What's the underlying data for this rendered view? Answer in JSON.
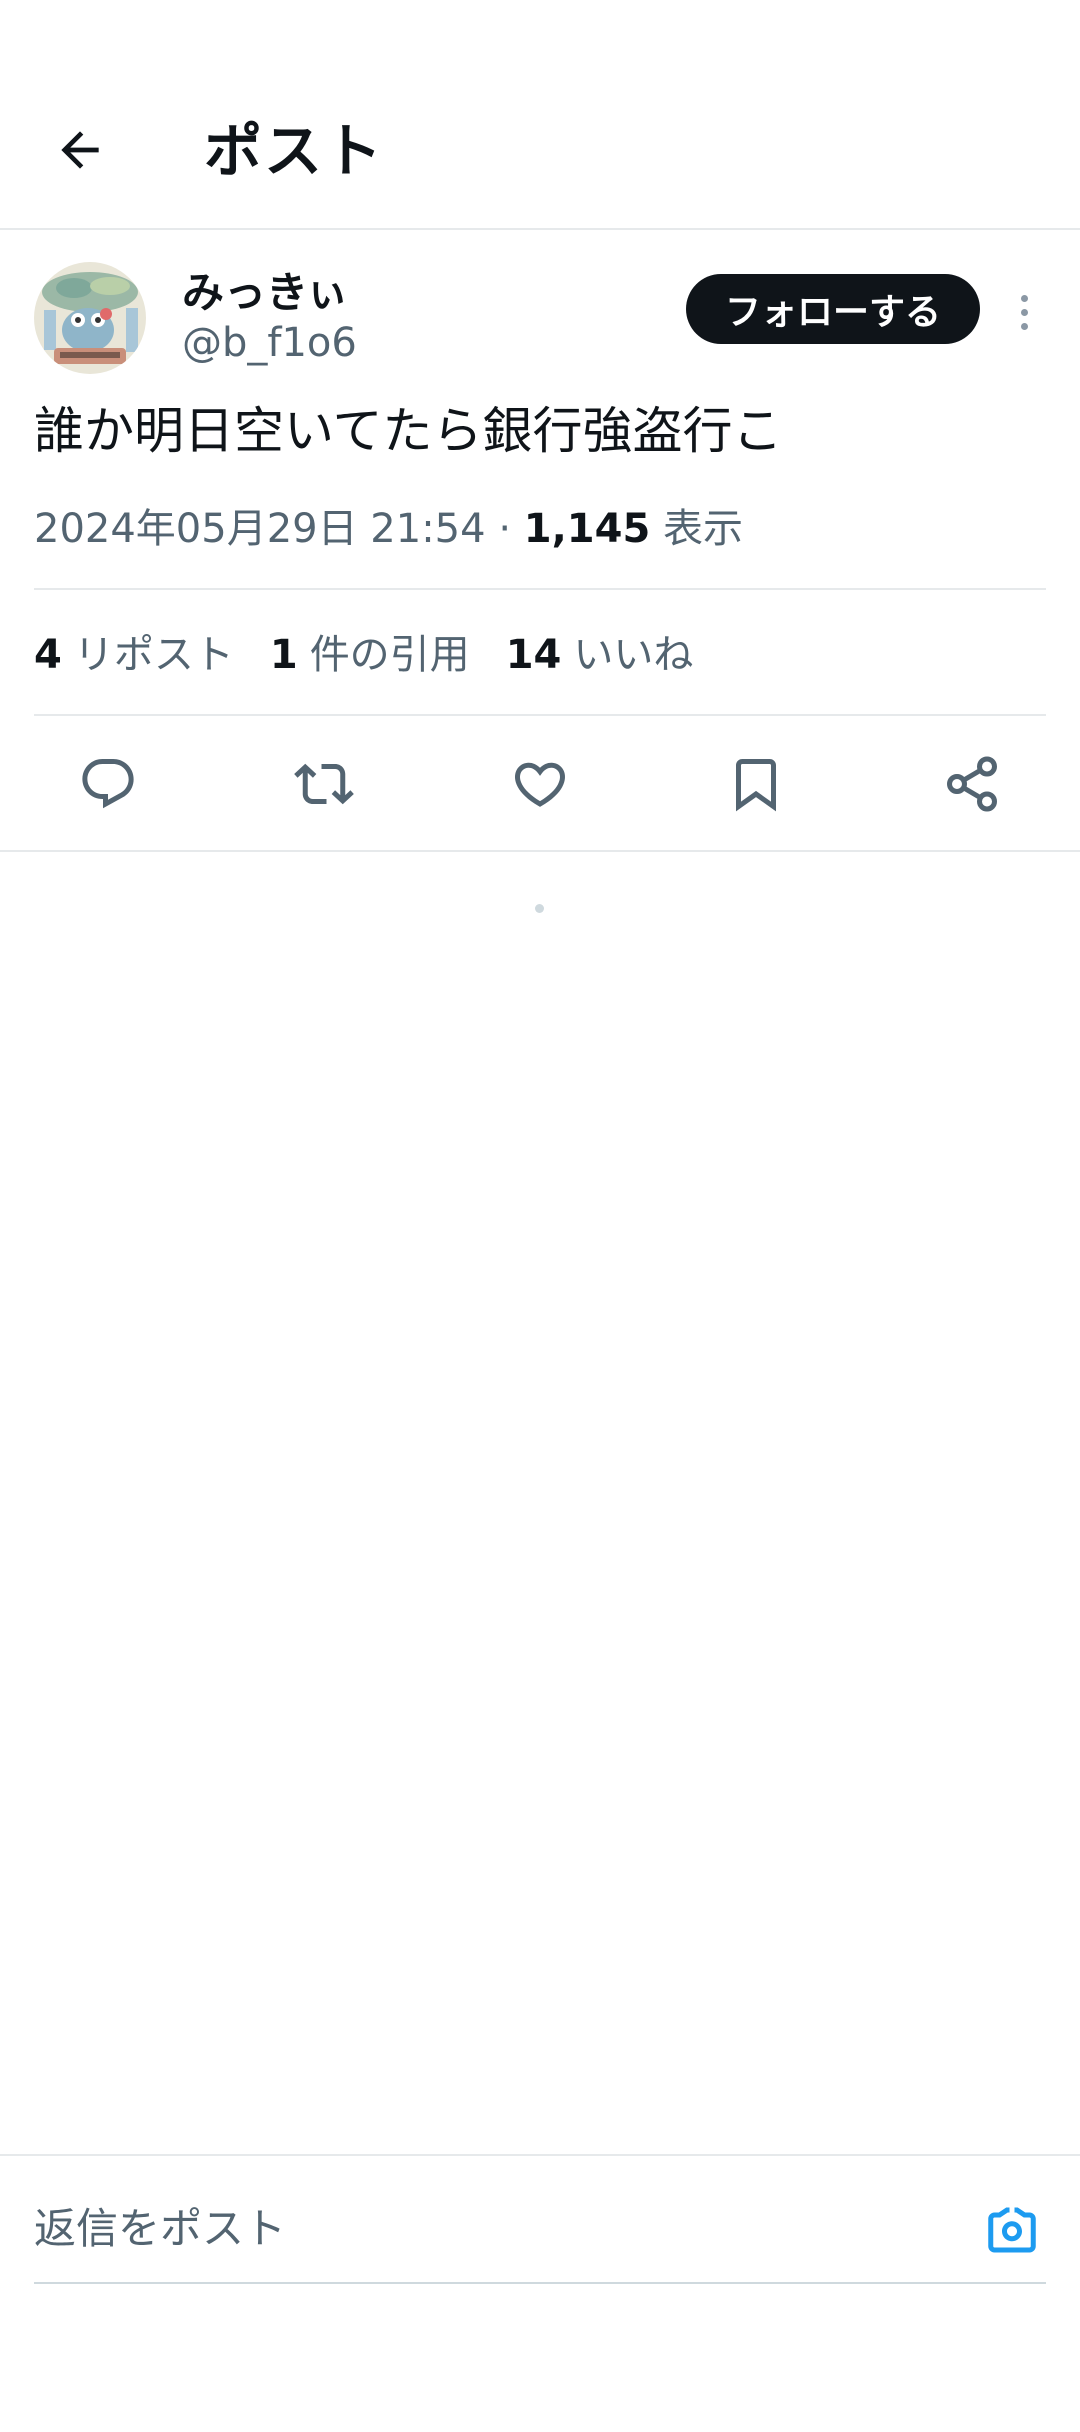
{
  "header": {
    "back_icon": "arrow-left-icon",
    "title": "ポスト"
  },
  "post": {
    "author": {
      "display_name": "みっきぃ",
      "handle": "@b_f1o6",
      "avatar": "frog-illustration-avatar"
    },
    "follow_label": "フォローする",
    "more_icon": "more-vertical-icon",
    "text": "誰か明日空いてたら銀行強盗行こ",
    "meta": {
      "timestamp": "2024年05月29日 21:54",
      "separator": "·",
      "views_count": "1,145",
      "views_label": "表示"
    },
    "stats": {
      "reposts_count": "4",
      "reposts_label": "リポスト",
      "quotes_count": "1",
      "quotes_label": "件の引用",
      "likes_count": "14",
      "likes_label": "いいね"
    },
    "actions": [
      {
        "name": "reply",
        "icon": "reply-icon"
      },
      {
        "name": "repost",
        "icon": "repost-icon"
      },
      {
        "name": "like",
        "icon": "heart-icon"
      },
      {
        "name": "bookmark",
        "icon": "bookmark-icon"
      },
      {
        "name": "share",
        "icon": "share-icon"
      }
    ]
  },
  "reply_bar": {
    "placeholder": "返信をポスト",
    "camera_icon": "camera-icon"
  },
  "colors": {
    "text_primary": "#0f1419",
    "text_secondary": "#536471",
    "accent": "#1d9bf0",
    "divider": "#e6e9eb"
  }
}
